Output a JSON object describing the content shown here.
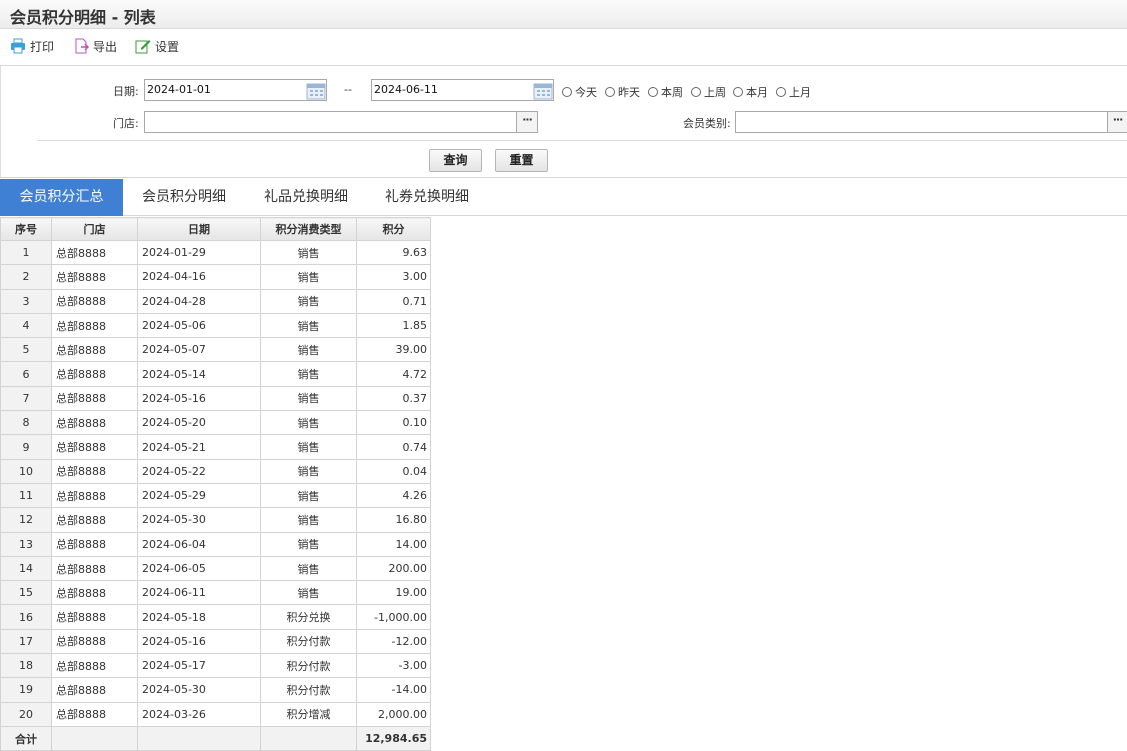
{
  "window": {
    "title": "会员积分明细 - 列表"
  },
  "toolbar": {
    "print": "打印",
    "export": "导出",
    "settings": "设置"
  },
  "filter": {
    "date_label": "日期:",
    "date_from": "2024-01-01",
    "date_sep": "--",
    "date_to": "2024-06-11",
    "quick_ranges": [
      "今天",
      "昨天",
      "本周",
      "上周",
      "本月",
      "上月"
    ],
    "store_label": "门店:",
    "store_value": "",
    "member_type_label": "会员类别:",
    "member_type_value": "",
    "dots": "···",
    "query_button": "查询",
    "reset_button": "重置"
  },
  "tabs": [
    "会员积分汇总",
    "会员积分明细",
    "礼品兑换明细",
    "礼券兑换明细"
  ],
  "active_tab": 0,
  "table": {
    "columns": [
      "序号",
      "门店",
      "日期",
      "积分消费类型",
      "积分"
    ],
    "rows": [
      [
        "1",
        "总部8888",
        "2024-01-29",
        "销售",
        "9.63"
      ],
      [
        "2",
        "总部8888",
        "2024-04-16",
        "销售",
        "3.00"
      ],
      [
        "3",
        "总部8888",
        "2024-04-28",
        "销售",
        "0.71"
      ],
      [
        "4",
        "总部8888",
        "2024-05-06",
        "销售",
        "1.85"
      ],
      [
        "5",
        "总部8888",
        "2024-05-07",
        "销售",
        "39.00"
      ],
      [
        "6",
        "总部8888",
        "2024-05-14",
        "销售",
        "4.72"
      ],
      [
        "7",
        "总部8888",
        "2024-05-16",
        "销售",
        "0.37"
      ],
      [
        "8",
        "总部8888",
        "2024-05-20",
        "销售",
        "0.10"
      ],
      [
        "9",
        "总部8888",
        "2024-05-21",
        "销售",
        "0.74"
      ],
      [
        "10",
        "总部8888",
        "2024-05-22",
        "销售",
        "0.04"
      ],
      [
        "11",
        "总部8888",
        "2024-05-29",
        "销售",
        "4.26"
      ],
      [
        "12",
        "总部8888",
        "2024-05-30",
        "销售",
        "16.80"
      ],
      [
        "13",
        "总部8888",
        "2024-06-04",
        "销售",
        "14.00"
      ],
      [
        "14",
        "总部8888",
        "2024-06-05",
        "销售",
        "200.00"
      ],
      [
        "15",
        "总部8888",
        "2024-06-11",
        "销售",
        "19.00"
      ],
      [
        "16",
        "总部8888",
        "2024-05-18",
        "积分兑换",
        "-1,000.00"
      ],
      [
        "17",
        "总部8888",
        "2024-05-16",
        "积分付款",
        "-12.00"
      ],
      [
        "18",
        "总部8888",
        "2024-05-17",
        "积分付款",
        "-3.00"
      ],
      [
        "19",
        "总部8888",
        "2024-05-30",
        "积分付款",
        "-14.00"
      ],
      [
        "20",
        "总部8888",
        "2024-03-26",
        "积分增减",
        "2,000.00"
      ]
    ],
    "total_label": "合计",
    "total_value": "12,984.65"
  },
  "colors": {
    "active_tab": "#3f80d5",
    "print_icon": "#3aa0d8",
    "export_icon": "#c050c0",
    "settings_icon": "#3a9a3a"
  }
}
